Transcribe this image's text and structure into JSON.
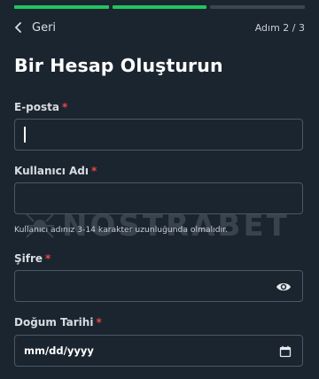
{
  "progress": {
    "total_steps": 3,
    "completed_steps": 2
  },
  "nav": {
    "back_label": "Geri",
    "step_label": "Adım 2 / 3"
  },
  "page": {
    "title": "Bir Hesap Oluşturun"
  },
  "watermark": {
    "text": "NOSTRABET"
  },
  "form": {
    "email": {
      "label": "E-posta",
      "required_mark": "*",
      "value": ""
    },
    "username": {
      "label": "Kullanıcı Adı",
      "required_mark": "*",
      "value": "",
      "hint": "Kullanıcı adınız 3-14 karakter uzunluğunda olmalıdır."
    },
    "password": {
      "label": "Şifre",
      "required_mark": "*",
      "value": "",
      "toggle_icon": "eye-icon"
    },
    "birthdate": {
      "label": "Doğum Tarihi",
      "required_mark": "*",
      "placeholder": "mm/dd/yyyy",
      "picker_icon": "calendar-icon"
    }
  },
  "colors": {
    "background": "#1b2530",
    "progress_active": "#22c55e",
    "progress_inactive": "#3a4652",
    "required": "#ef4444",
    "border": "#4a5866"
  }
}
